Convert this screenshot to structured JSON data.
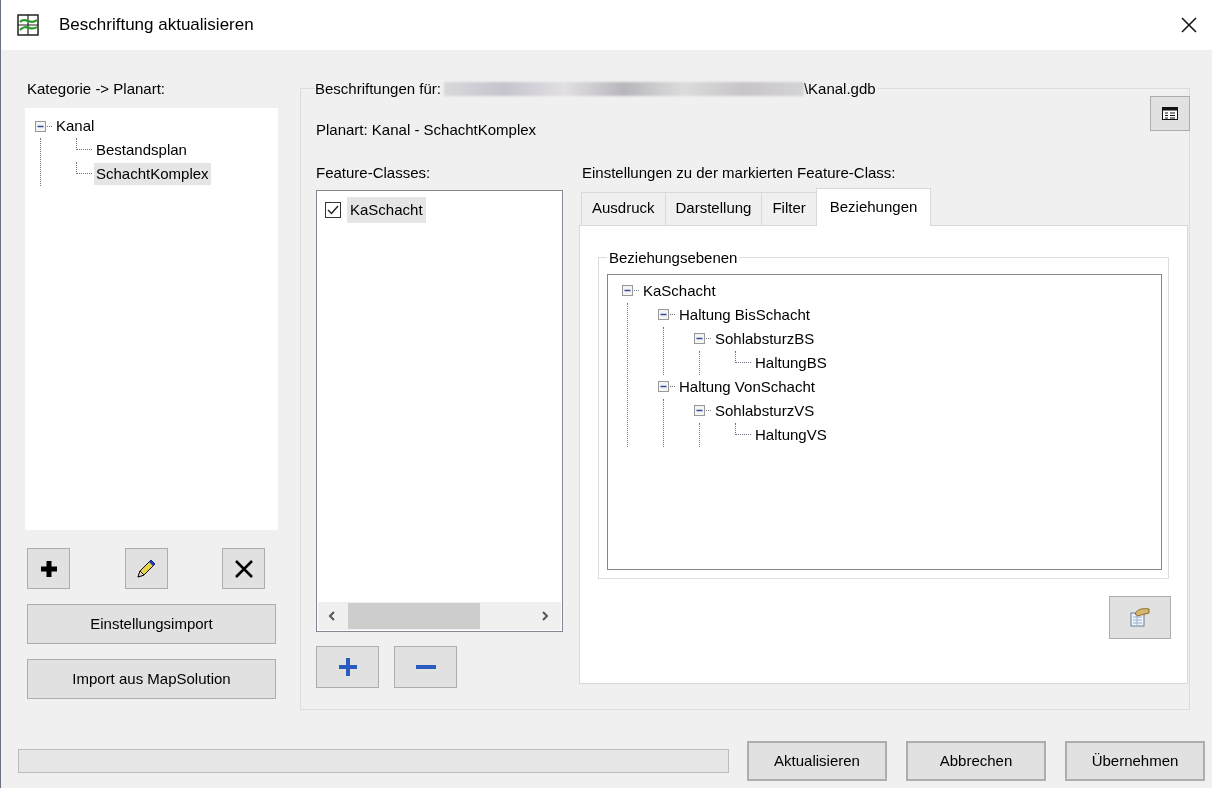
{
  "window": {
    "title": "Beschriftung aktualisieren"
  },
  "category_panel": {
    "label": "Kategorie -> Planart:",
    "tree": [
      {
        "label": "Kanal",
        "expanded": true,
        "selected": false,
        "children": [
          {
            "label": "Bestandsplan",
            "selected": false
          },
          {
            "label": "SchachtKomplex",
            "selected": true
          }
        ]
      }
    ],
    "icon_buttons": [
      {
        "kind": "add"
      },
      {
        "kind": "edit"
      },
      {
        "kind": "delete"
      }
    ],
    "buttons": [
      "Einstellungsimport",
      "Import aus MapSolution"
    ]
  },
  "labels_group": {
    "legend": "Beschriftungen für:",
    "path_end": "\\Kanal.gdb",
    "plan_type": "Planart: Kanal - SchachtKomplex",
    "feature_classes": {
      "label": "Feature-Classes:",
      "items": [
        {
          "label": "KaSchacht",
          "checked": true,
          "selected": true
        }
      ]
    },
    "settings": {
      "label": "Einstellungen zu der markierten Feature-Class:",
      "tabs": [
        {
          "label": "Ausdruck",
          "selected": false
        },
        {
          "label": "Darstellung",
          "selected": false
        },
        {
          "label": "Filter",
          "selected": false
        },
        {
          "label": "Beziehungen",
          "selected": true
        }
      ],
      "relations": {
        "legend": "Beziehungsebenen",
        "tree": [
          {
            "label": "KaSchacht",
            "expanded": true,
            "children": [
              {
                "label": "Haltung BisSchacht",
                "expanded": true,
                "children": [
                  {
                    "label": "SohlabsturzBS",
                    "expanded": true,
                    "children": [
                      {
                        "label": "HaltungBS"
                      }
                    ]
                  }
                ]
              },
              {
                "label": "Haltung VonSchacht",
                "expanded": true,
                "children": [
                  {
                    "label": "SohlabsturzVS",
                    "expanded": true,
                    "children": [
                      {
                        "label": "HaltungVS"
                      }
                    ]
                  }
                ]
              }
            ]
          }
        ]
      }
    }
  },
  "footer": {
    "progress": {
      "level": 0
    },
    "buttons": [
      "Aktualisieren",
      "Abbrechen",
      "Übernehmen"
    ]
  }
}
